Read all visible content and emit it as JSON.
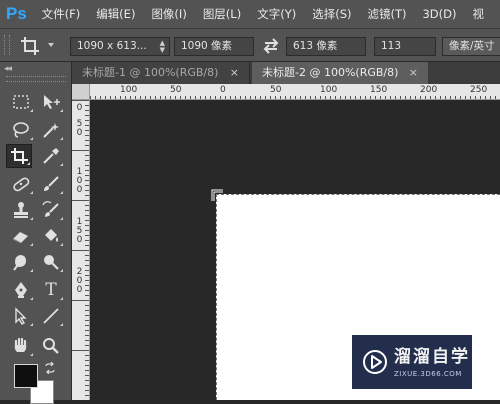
{
  "app": {
    "logo_text": "Ps"
  },
  "menu": {
    "items": [
      {
        "label": "文件(F)"
      },
      {
        "label": "编辑(E)"
      },
      {
        "label": "图像(I)"
      },
      {
        "label": "图层(L)"
      },
      {
        "label": "文字(Y)"
      },
      {
        "label": "选择(S)"
      },
      {
        "label": "滤镜(T)"
      },
      {
        "label": "3D(D)"
      },
      {
        "label": "视"
      }
    ]
  },
  "options_bar": {
    "tool_icon": "crop-icon",
    "ratio_value": "1090 x 613...",
    "width_value": "1090 像素",
    "height_value": "613 像素",
    "resolution_value": "113",
    "unit_value": "像素/英寸"
  },
  "tabs": [
    {
      "label": "未标题-1 @ 100%(RGB/8)",
      "close": "×",
      "active": false
    },
    {
      "label": "未标题-2 @ 100%(RGB/8)",
      "close": "×",
      "active": true
    }
  ],
  "toolbar": {
    "collapse_label": "◂◂",
    "tools": [
      {
        "name": "rectangular-marquee-icon"
      },
      {
        "name": "move-icon"
      },
      {
        "name": "lasso-icon"
      },
      {
        "name": "magic-wand-icon"
      },
      {
        "name": "crop-icon",
        "selected": true
      },
      {
        "name": "eyedropper-icon"
      },
      {
        "name": "healing-brush-icon"
      },
      {
        "name": "brush-icon"
      },
      {
        "name": "clone-stamp-icon"
      },
      {
        "name": "history-brush-icon"
      },
      {
        "name": "eraser-icon"
      },
      {
        "name": "paint-bucket-icon"
      },
      {
        "name": "blur-icon"
      },
      {
        "name": "dodge-icon"
      },
      {
        "name": "pen-icon"
      },
      {
        "name": "type-icon"
      },
      {
        "name": "path-selection-icon"
      },
      {
        "name": "line-icon"
      },
      {
        "name": "hand-icon"
      },
      {
        "name": "zoom-icon"
      }
    ],
    "type_tool_glyph": "T",
    "foreground_color": "#0f0f0f",
    "background_color": "#ffffff"
  },
  "rulers": {
    "horizontal_labels": [
      "100",
      "50",
      "0",
      "50",
      "100",
      "150",
      "200",
      "250"
    ],
    "vertical_labels": [
      "0",
      "5",
      "0",
      "1",
      "0",
      "0",
      "1",
      "5",
      "0",
      "2",
      "0",
      "0"
    ]
  },
  "watermark": {
    "title": "溜溜自学",
    "subtitle": "ZIXUE.3D66.COM",
    "bg_color": "#232e4d"
  },
  "colors": {
    "panel_bg": "#535353",
    "canvas_bg": "#282828",
    "ps_blue": "#31a8ff"
  }
}
